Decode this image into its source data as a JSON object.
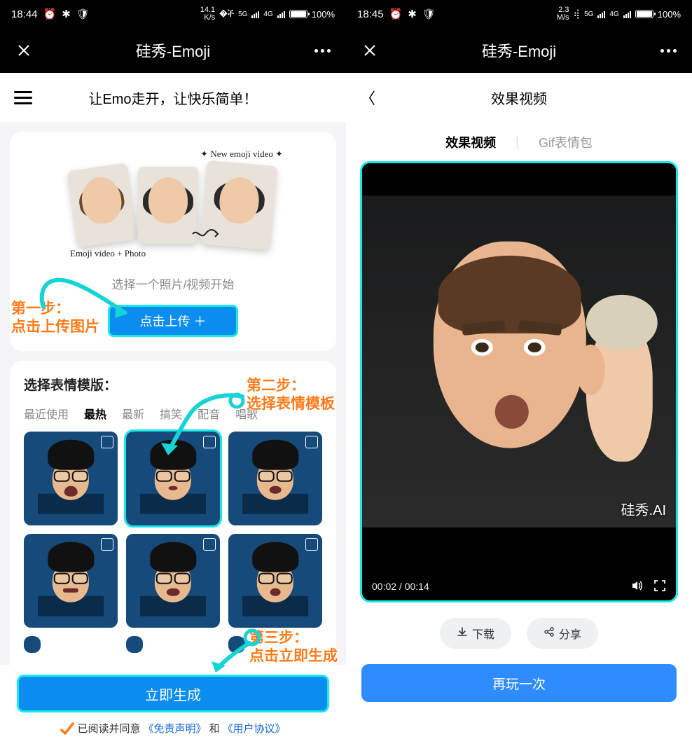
{
  "left": {
    "status": {
      "time": "18:44",
      "net": "14.1\nK/s",
      "battery": "100%"
    },
    "titlebar": {
      "title": "硅秀-Emoji"
    },
    "subheader": {
      "tagline": "让Emo走开，让快乐简单！"
    },
    "hero": {
      "label_top": "✦ New emoji video ✦",
      "label_bottom": "Emoji video + Photo",
      "select_hint": "选择一个照片/视频开始",
      "upload_btn": "点击上传 ＋"
    },
    "templates": {
      "title": "选择表情模版：",
      "tabs": [
        "最近使用",
        "最热",
        "最新",
        "搞笑",
        "配音",
        "唱歌"
      ],
      "active_tab": "最热"
    },
    "generate_btn": "立即生成",
    "agree": {
      "prefix": "已阅读并同意",
      "link1": "《免责声明》",
      "mid": "和",
      "link2": "《用户协议》"
    },
    "annotations": {
      "step1a": "第一步：",
      "step1b": "点击上传图片",
      "step2a": "第二步：",
      "step2b": "选择表情模板",
      "step3a": "第三步：",
      "step3b": "点击立即生成"
    }
  },
  "right": {
    "status": {
      "time": "18:45",
      "net": "2.3\nM/s",
      "battery": "100%"
    },
    "titlebar": {
      "title": "硅秀-Emoji"
    },
    "subheader": {
      "title": "效果视频"
    },
    "tabs": {
      "a": "效果视频",
      "b": "Gif表情包"
    },
    "video": {
      "watermark": "硅秀.AI",
      "time": "00:02 / 00:14"
    },
    "actions": {
      "download": "下载",
      "share": "分享"
    },
    "again_btn": "再玩一次"
  }
}
